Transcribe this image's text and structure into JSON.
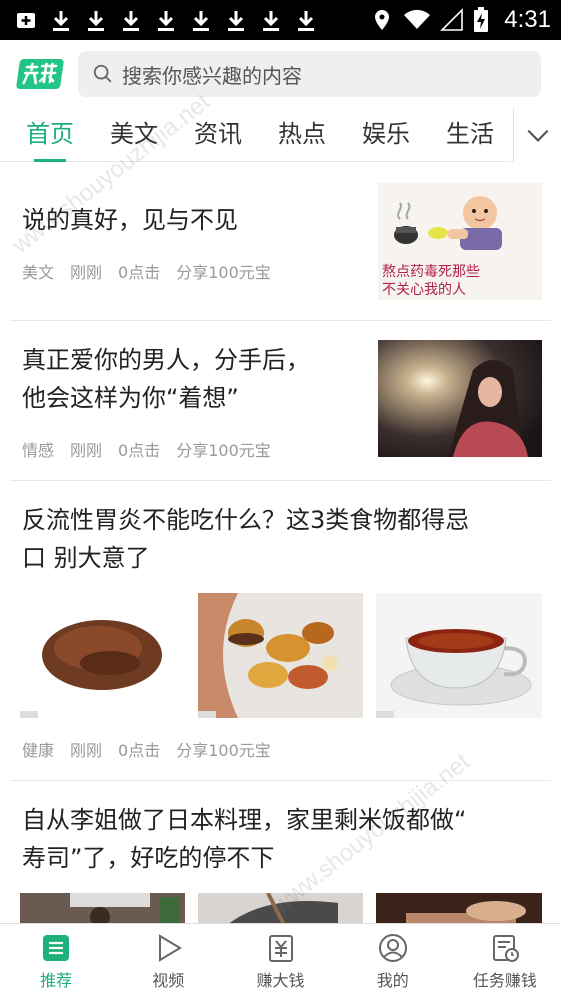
{
  "status_bar": {
    "time": "4:31",
    "icons": [
      "add-box-icon",
      "download-icon",
      "download-icon",
      "download-icon",
      "download-icon",
      "download-icon",
      "download-icon",
      "download-icon",
      "download-icon",
      "location-icon",
      "wifi-icon",
      "signal-icon",
      "battery-charging-icon"
    ]
  },
  "header": {
    "logo_text": "芝麻",
    "search_placeholder": "搜索你感兴趣的内容"
  },
  "tabs": [
    "首页",
    "美文",
    "资讯",
    "热点",
    "娱乐",
    "生活"
  ],
  "active_tab": 0,
  "feed": [
    {
      "title": "说的真好，见与不见",
      "category": "美文",
      "time": "刚刚",
      "clicks": "0点击",
      "share": "分享100元宝",
      "image_caption_line1": "熬点药毒死那些",
      "image_caption_line2": "不关心我的人"
    },
    {
      "title_line1": "真正爱你的男人，分手后，",
      "title_line2": "他会这样为你“着想”",
      "category": "情感",
      "time": "刚刚",
      "clicks": "0点击",
      "share": "分享100元宝"
    },
    {
      "title_line1": "反流性胃炎不能吃什么？这3类食物都得忌",
      "title_line2": "口 别大意了",
      "category": "健康",
      "time": "刚刚",
      "clicks": "0点击",
      "share": "分享100元宝"
    },
    {
      "title_line1": "自从李姐做了日本料理，家里剩米饭都做“",
      "title_line2": "寿司”了，好吃的停不下"
    }
  ],
  "bottom_nav": [
    {
      "label": "推荐",
      "icon": "recommend-icon"
    },
    {
      "label": "视频",
      "icon": "play-icon"
    },
    {
      "label": "赚大钱",
      "icon": "money-icon"
    },
    {
      "label": "我的",
      "icon": "user-icon"
    },
    {
      "label": "任务赚钱",
      "icon": "task-icon"
    }
  ],
  "active_nav": 0,
  "watermark": "www.shouyouzhijia.net",
  "colors": {
    "accent": "#1db07a",
    "logo": "#22c487",
    "status_bar": "#000000"
  }
}
